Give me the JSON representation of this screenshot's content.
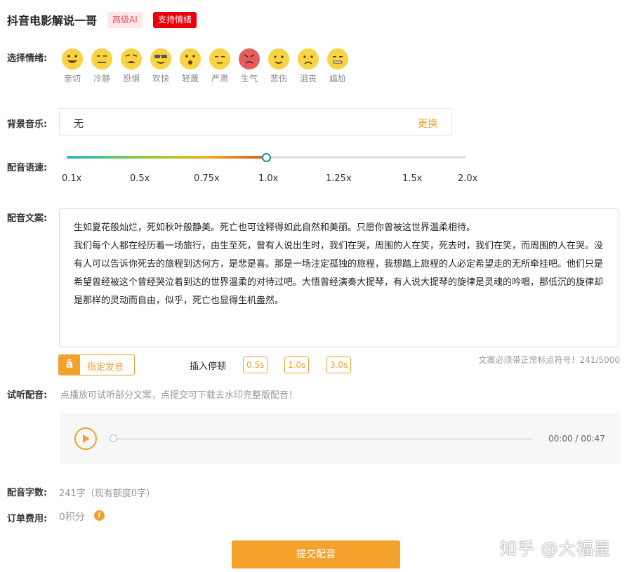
{
  "header": {
    "title": "抖音电影解说一哥",
    "badge_ai": "高级AI",
    "badge_emotion": "支持情绪"
  },
  "emotion": {
    "label": "选择情绪:",
    "items": [
      {
        "name": "亲切",
        "icon": "grin-face-icon",
        "color": "#f8d343"
      },
      {
        "name": "冷静",
        "icon": "neutral-face-icon",
        "color": "#f8d343"
      },
      {
        "name": "恐惧",
        "icon": "fearful-face-icon",
        "color": "#f8d343"
      },
      {
        "name": "欢快",
        "icon": "sunglasses-face-icon",
        "color": "#f8d343"
      },
      {
        "name": "轻蔑",
        "icon": "surprised-face-icon",
        "color": "#f8d343"
      },
      {
        "name": "严肃",
        "icon": "serious-face-icon",
        "color": "#f8d343"
      },
      {
        "name": "生气",
        "icon": "angry-face-icon",
        "color": "#e35d5d"
      },
      {
        "name": "悲伤",
        "icon": "sad-face-icon",
        "color": "#f8d343"
      },
      {
        "name": "沮丧",
        "icon": "frowning-face-icon",
        "color": "#f8d343"
      },
      {
        "name": "尴尬",
        "icon": "awkward-face-icon",
        "color": "#f8d343"
      }
    ]
  },
  "bgm": {
    "label": "背景音乐:",
    "value": "无",
    "change": "更换"
  },
  "speed": {
    "label": "配音语速:",
    "ticks": [
      "0.1x",
      "0.5x",
      "0.75x",
      "1.0x",
      "1.25x",
      "1.5x",
      "2.0x"
    ],
    "selected": "1.0x"
  },
  "script": {
    "label": "配音文案:",
    "paragraphs": [
      "生如夏花般灿烂，死如秋叶般静美。死亡也可诠释得如此自然和美丽。只愿你曾被这世界温柔相待。",
      "我们每个人都在经历着一场旅行，由生至死，曾有人说出生时，我们在哭，周围的人在笑，死去时，我们在笑，而周围的人在哭。没有人可以告诉你死去的旅程到达何方，是悲是喜。那是一场注定孤独的旅程，我想踏上旅程的人必定希望走的无所牵挂吧。他们只是希望曾经被这个曾经哭泣着到达的世界温柔的对待过吧。大悟曾经演奏大提琴，有人说大提琴的旋律是灵魂的吟唱，那低沉的旋律却是那样的灵动而自由，似乎，死亡也显得生机盎然。"
    ]
  },
  "tools": {
    "pron_icon": "ā",
    "pron_label": "指定发音",
    "pause_label": "插入停顿",
    "pauses": [
      "0.5s",
      "1.0s",
      "3.0s"
    ],
    "count_hint": "文案必须带正常标点符号！241/5000"
  },
  "preview": {
    "label": "试听配音:",
    "hint": "点播放可试听部分文案，点提交可下载去水印完整版配音！",
    "time": "00:00 / 00:47",
    "progress": 0
  },
  "word_count": {
    "label": "配音字数:",
    "value": "241字（现有额度0字）"
  },
  "fee": {
    "label": "订单费用:",
    "value": "0积分",
    "info_icon": "i"
  },
  "submit": {
    "label": "提交配音"
  },
  "watermark": {
    "text": "知乎 @大福星"
  },
  "colors": {
    "accent": "#f5a22c",
    "badge_red": "#e8000c",
    "slider_knob": "#1c8e8e"
  }
}
